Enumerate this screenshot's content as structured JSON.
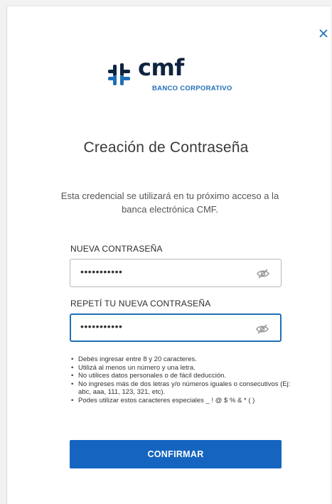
{
  "logo": {
    "wordmark": "cmf",
    "subtitle": "BANCO CORPORATIVO",
    "brand_navy": "#0f2440",
    "brand_blue": "#1f6fb8"
  },
  "close_icon": "close-icon",
  "page_title": "Creación de Contraseña",
  "description": "Esta credencial se utilizará en tu próximo acceso a la banca electrónica CMF.",
  "fields": {
    "new_password": {
      "label": "NUEVA CONTRASEÑA",
      "value": "•••••••••••",
      "icon": "eye-slash-icon"
    },
    "repeat_password": {
      "label": "REPETÍ TU NUEVA CONTRASEÑA",
      "value": "•••••••••••",
      "icon": "eye-slash-icon",
      "focused": true
    }
  },
  "rules": [
    "Debés ingresar entre 8 y 20 caracteres.",
    "Utilizá al menos un número y una letra.",
    "No utilices datos personales o de fácil deducción.",
    "No ingreses más de dos letras y/o números iguales o consecutivos (Ej: abc, aaa, 111, 123, 321, etc).",
    "Podes utilizar estos caracteres especiales _ ! @ $ % & * ( )"
  ],
  "confirm_button": {
    "label": "CONFIRMAR",
    "color": "#1565c0"
  }
}
